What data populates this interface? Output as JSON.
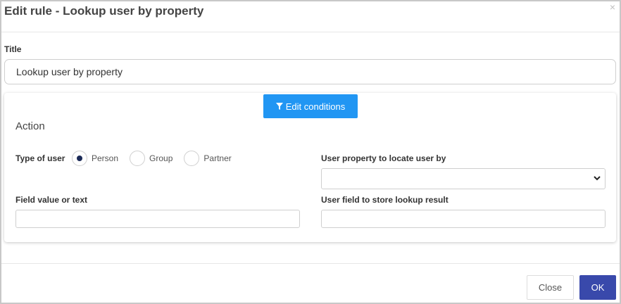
{
  "dialog": {
    "title": "Edit rule - Lookup user by property",
    "close_glyph": "×"
  },
  "title_field": {
    "label": "Title",
    "value": "Lookup user by property"
  },
  "conditions": {
    "button_label": "Edit conditions",
    "icon": "filter-icon"
  },
  "action": {
    "heading": "Action",
    "type_of_user": {
      "label": "Type of user",
      "options": [
        {
          "label": "Person",
          "checked": true
        },
        {
          "label": "Group",
          "checked": false
        },
        {
          "label": "Partner",
          "checked": false
        }
      ]
    },
    "user_property": {
      "label": "User property to locate user by",
      "selected": ""
    },
    "field_value": {
      "label": "Field value or text",
      "value": ""
    },
    "store_field": {
      "label": "User field to store lookup result",
      "value": ""
    }
  },
  "footer": {
    "close_label": "Close",
    "ok_label": "OK"
  },
  "colors": {
    "primary_button": "#2196f3",
    "ok_button": "#3949ab",
    "radio_checked": "#1b2a57"
  }
}
